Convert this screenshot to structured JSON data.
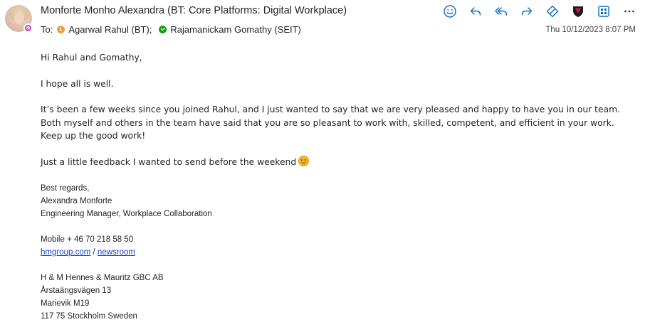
{
  "header": {
    "sender": "Monforte Monho Alexandra (BT: Core Platforms: Digital Workplace)",
    "to_label": "To:",
    "recipients": [
      {
        "name": "Agarwal Rahul (BT);",
        "status": "away"
      },
      {
        "name": "Rajamanickam Gomathy (SEIT)",
        "status": "available"
      }
    ],
    "date": "Thu 10/12/2023 8:07 PM"
  },
  "toolbar": {
    "icons": [
      "emoji-icon",
      "reply-icon",
      "reply-all-icon",
      "forward-icon",
      "tag-icon",
      "shield-icon",
      "apps-icon",
      "more-icon"
    ]
  },
  "body": {
    "greeting": "Hi Rahul and Gomathy,",
    "p1": "I hope all is well.",
    "p2": "It’s been a few weeks since you joined Rahul, and I just wanted to say that we are very pleased and happy to have you in our team. Both myself and others in the team have said that you are so pleasant to work with, skilled, competent, and efficient in your work. Keep up the good work!",
    "p3": "Just a little feedback I wanted to send before the weekend"
  },
  "signature": {
    "closing": "Best regards,",
    "name": "Alexandra Monforte",
    "title": "Engineering Manager, Workplace Collaboration",
    "mobile": "Mobile + 46 70 218 58 50",
    "link1": "hmgroup.com",
    "link_sep": "/",
    "link2": "newsroom",
    "company": "H & M Hennes & Mauritz GBC AB",
    "street": "Årstaängsvägen 13",
    "area": "Marievik M19",
    "city": "117 75 Stockholm Sweden"
  },
  "colors": {
    "accent": "#0f6cbd",
    "shield": "#8b1538",
    "presence": "#b146c2",
    "away": "#e8a33c",
    "available": "#13a10e"
  }
}
